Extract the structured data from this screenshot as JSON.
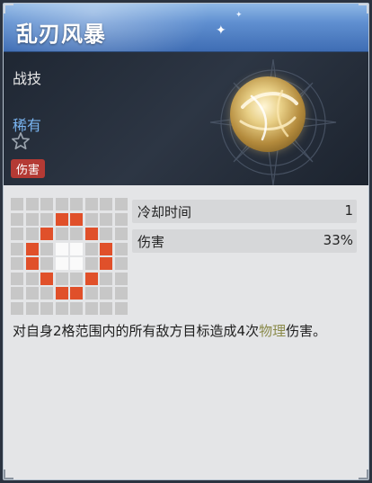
{
  "skill": {
    "title": "乱刃风暴",
    "category": "战技",
    "rarity": "稀有",
    "tag": "伤害",
    "colors": {
      "accent_blue": "#79b4f0",
      "tag_red": "#b43a34",
      "area_red": "#e0502a",
      "keyword": "#8a8a4a"
    }
  },
  "stats": [
    {
      "label": "冷却时间",
      "value": "1"
    },
    {
      "label": "伤害",
      "value": "33%"
    }
  ],
  "range_grid": {
    "rows": 8,
    "cols": 8,
    "target_cells": [
      [
        1,
        3
      ],
      [
        1,
        4
      ],
      [
        2,
        2
      ],
      [
        2,
        5
      ],
      [
        3,
        1
      ],
      [
        3,
        6
      ],
      [
        4,
        1
      ],
      [
        4,
        6
      ],
      [
        5,
        2
      ],
      [
        5,
        5
      ],
      [
        6,
        3
      ],
      [
        6,
        4
      ]
    ],
    "center_cells": [
      [
        3,
        3
      ],
      [
        3,
        4
      ],
      [
        4,
        3
      ],
      [
        4,
        4
      ]
    ]
  },
  "description": {
    "before": "对自身2格范围内的所有敌方目标造成4次",
    "keyword": "物理",
    "after": "伤害。"
  },
  "icons": [
    "star-outline-icon",
    "compass-emblem-icon",
    "skill-orb-icon",
    "sparkle-icon",
    "corner-ornament-icon"
  ]
}
